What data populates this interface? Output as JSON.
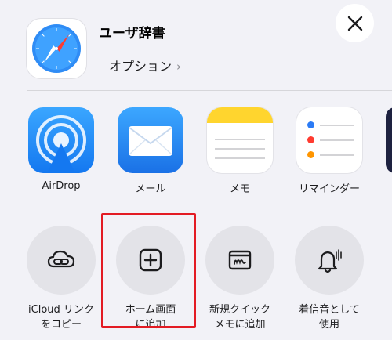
{
  "header": {
    "app_title": "ユーザ辞書",
    "options_label": "オプション",
    "options_chevron": "›",
    "close_label": "×"
  },
  "share_apps": [
    {
      "label": "AirDrop",
      "icon": "airdrop-icon"
    },
    {
      "label": "メール",
      "icon": "mail-icon"
    },
    {
      "label": "メモ",
      "icon": "notes-icon"
    },
    {
      "label": "リマインダー",
      "icon": "reminders-icon"
    }
  ],
  "actions": [
    {
      "label": "iCloud リンク\nをコピー",
      "icon": "cloud-link-icon"
    },
    {
      "label": "ホーム画面\nに追加",
      "icon": "add-square-icon",
      "highlighted": true
    },
    {
      "label": "新規クイック\nメモに追加",
      "icon": "quick-note-icon"
    },
    {
      "label": "着信音として\n使用",
      "icon": "bell-icon"
    }
  ],
  "colors": {
    "background": "#f2f2f7",
    "highlight": "#e31b23",
    "airdrop": "#1478f0",
    "memo_yellow": "#ffd52e"
  }
}
